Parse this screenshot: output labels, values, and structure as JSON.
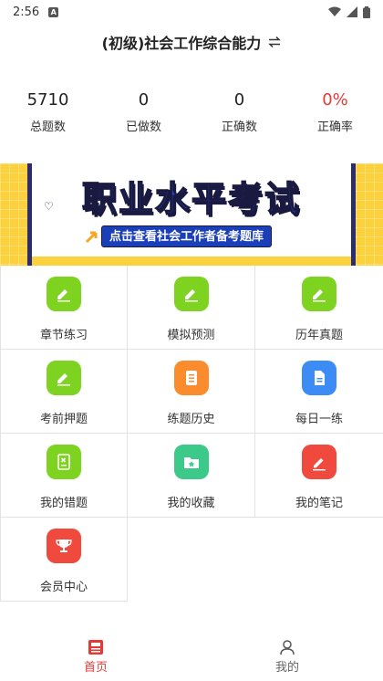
{
  "status_bar": {
    "time": "2:56",
    "notif_badge": "A"
  },
  "header": {
    "title": "(初级)社会工作综合能力"
  },
  "stats": [
    {
      "value": "5710",
      "label": "总题数",
      "color": "#222222"
    },
    {
      "value": "0",
      "label": "已做数",
      "color": "#222222"
    },
    {
      "value": "0",
      "label": "正确数",
      "color": "#222222"
    },
    {
      "value": "0%",
      "label": "正确率",
      "color": "#e53935"
    }
  ],
  "banner": {
    "title": "职业水平考试",
    "subtitle": "点击查看社会工作者备考题库"
  },
  "menu": [
    {
      "label": "章节练习",
      "icon": "pencil-icon",
      "color": "#7ed321"
    },
    {
      "label": "模拟预测",
      "icon": "pencil-icon",
      "color": "#7ed321"
    },
    {
      "label": "历年真题",
      "icon": "pencil-icon",
      "color": "#7ed321"
    },
    {
      "label": "考前押题",
      "icon": "pencil-icon",
      "color": "#7ed321"
    },
    {
      "label": "练题历史",
      "icon": "list-icon",
      "color": "#fb8c2e"
    },
    {
      "label": "每日一练",
      "icon": "document-icon",
      "color": "#3d8bf5"
    },
    {
      "label": "我的错题",
      "icon": "notebook-icon",
      "color": "#7ed321"
    },
    {
      "label": "我的收藏",
      "icon": "star-folder-icon",
      "color": "#3cc98a"
    },
    {
      "label": "我的笔记",
      "icon": "edit-icon",
      "color": "#f04a3e"
    },
    {
      "label": "会员中心",
      "icon": "trophy-icon",
      "color": "#f04a3e"
    }
  ],
  "tabbar": [
    {
      "label": "首页",
      "icon": "home-icon",
      "active": true
    },
    {
      "label": "我的",
      "icon": "user-icon",
      "active": false
    }
  ],
  "colors": {
    "accent": "#e53935",
    "green": "#7ed321",
    "banner_yellow": "#fbd23d",
    "banner_blue": "#1b4bd8"
  }
}
